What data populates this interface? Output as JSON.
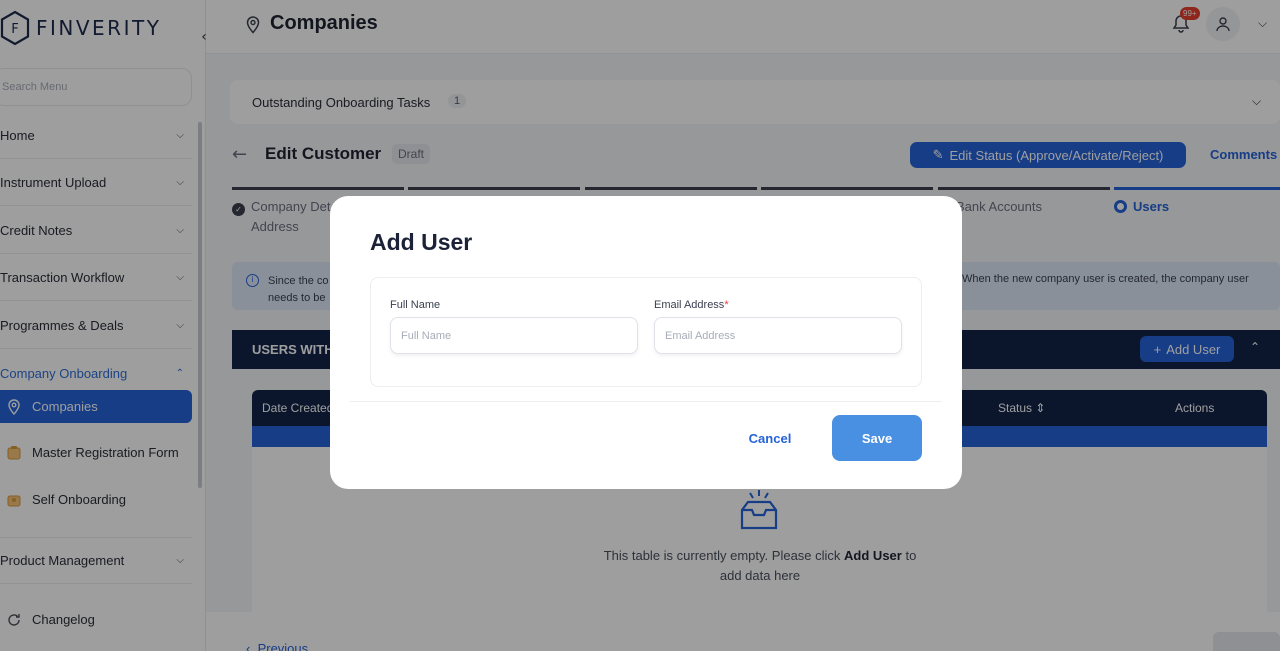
{
  "brand": {
    "name": "FINVERITY",
    "logo_letter": "F"
  },
  "sidebar": {
    "search_placeholder": "Search Menu",
    "items": [
      {
        "label": "Home"
      },
      {
        "label": "Instrument Upload"
      },
      {
        "label": "Credit Notes"
      },
      {
        "label": "Transaction Workflow"
      },
      {
        "label": "Programmes & Deals"
      },
      {
        "label": "Company Onboarding"
      }
    ],
    "sub_items": [
      {
        "label": "Companies"
      },
      {
        "label": "Master Registration Form"
      },
      {
        "label": "Self Onboarding"
      }
    ],
    "product_management": "Product Management",
    "changelog": "Changelog"
  },
  "header": {
    "title": "Companies",
    "notification_badge": "99+"
  },
  "main": {
    "outstanding_title": "Outstanding Onboarding Tasks",
    "outstanding_count": "1",
    "edit_title": "Edit Customer",
    "draft_badge": "Draft",
    "status_button": "Edit Status (Approve/Activate/Reject)",
    "comments_link": "Comments",
    "steps": [
      {
        "label": "Company Det",
        "label2": "Address"
      },
      {
        "label": "Bank Accounts"
      },
      {
        "label": "Users"
      }
    ],
    "info_left_1": "Since the co",
    "info_left_2": "needs to be",
    "info_right": "When the new company user is created, the company user",
    "users_section_title": "USERS WITH",
    "add_user_button": "Add User",
    "table_headers": {
      "date_created": "Date Created",
      "status": "Status",
      "actions": "Actions"
    },
    "empty_text_pre": "This table is currently empty. Please click",
    "empty_text_bold": "Add User",
    "empty_text_post": "to",
    "empty_text_line2": "add data here",
    "previous_button": "Previous"
  },
  "modal": {
    "title": "Add User",
    "full_name_label": "Full Name",
    "full_name_placeholder": "Full Name",
    "full_name_value": "",
    "email_label": "Email Address",
    "email_required_mark": "*",
    "email_placeholder": "Email Address",
    "email_value": "",
    "cancel_label": "Cancel",
    "save_label": "Save"
  },
  "colors": {
    "primary": "#2563d8",
    "navy": "#13254a",
    "save_button": "#4a90e2",
    "required": "#e53e3e"
  }
}
